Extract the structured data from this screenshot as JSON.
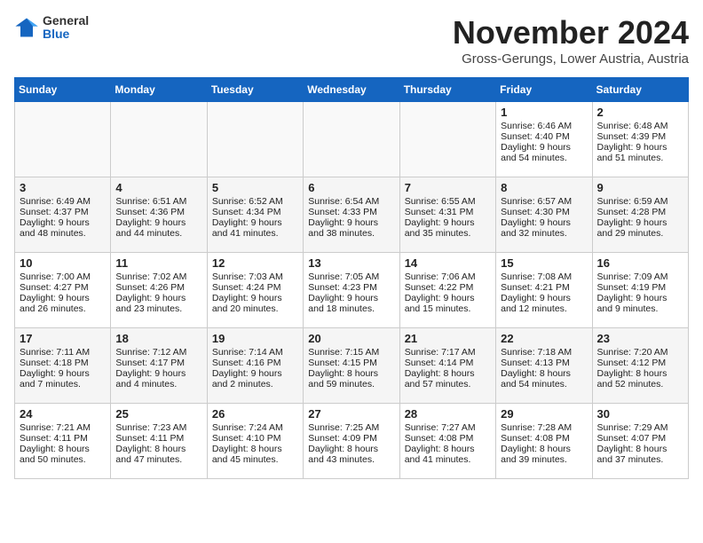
{
  "header": {
    "logo_general": "General",
    "logo_blue": "Blue",
    "month_title": "November 2024",
    "location": "Gross-Gerungs, Lower Austria, Austria"
  },
  "days_of_week": [
    "Sunday",
    "Monday",
    "Tuesday",
    "Wednesday",
    "Thursday",
    "Friday",
    "Saturday"
  ],
  "weeks": [
    {
      "days": [
        {
          "num": "",
          "content": ""
        },
        {
          "num": "",
          "content": ""
        },
        {
          "num": "",
          "content": ""
        },
        {
          "num": "",
          "content": ""
        },
        {
          "num": "",
          "content": ""
        },
        {
          "num": "1",
          "content": "Sunrise: 6:46 AM\nSunset: 4:40 PM\nDaylight: 9 hours and 54 minutes."
        },
        {
          "num": "2",
          "content": "Sunrise: 6:48 AM\nSunset: 4:39 PM\nDaylight: 9 hours and 51 minutes."
        }
      ]
    },
    {
      "days": [
        {
          "num": "3",
          "content": "Sunrise: 6:49 AM\nSunset: 4:37 PM\nDaylight: 9 hours and 48 minutes."
        },
        {
          "num": "4",
          "content": "Sunrise: 6:51 AM\nSunset: 4:36 PM\nDaylight: 9 hours and 44 minutes."
        },
        {
          "num": "5",
          "content": "Sunrise: 6:52 AM\nSunset: 4:34 PM\nDaylight: 9 hours and 41 minutes."
        },
        {
          "num": "6",
          "content": "Sunrise: 6:54 AM\nSunset: 4:33 PM\nDaylight: 9 hours and 38 minutes."
        },
        {
          "num": "7",
          "content": "Sunrise: 6:55 AM\nSunset: 4:31 PM\nDaylight: 9 hours and 35 minutes."
        },
        {
          "num": "8",
          "content": "Sunrise: 6:57 AM\nSunset: 4:30 PM\nDaylight: 9 hours and 32 minutes."
        },
        {
          "num": "9",
          "content": "Sunrise: 6:59 AM\nSunset: 4:28 PM\nDaylight: 9 hours and 29 minutes."
        }
      ]
    },
    {
      "days": [
        {
          "num": "10",
          "content": "Sunrise: 7:00 AM\nSunset: 4:27 PM\nDaylight: 9 hours and 26 minutes."
        },
        {
          "num": "11",
          "content": "Sunrise: 7:02 AM\nSunset: 4:26 PM\nDaylight: 9 hours and 23 minutes."
        },
        {
          "num": "12",
          "content": "Sunrise: 7:03 AM\nSunset: 4:24 PM\nDaylight: 9 hours and 20 minutes."
        },
        {
          "num": "13",
          "content": "Sunrise: 7:05 AM\nSunset: 4:23 PM\nDaylight: 9 hours and 18 minutes."
        },
        {
          "num": "14",
          "content": "Sunrise: 7:06 AM\nSunset: 4:22 PM\nDaylight: 9 hours and 15 minutes."
        },
        {
          "num": "15",
          "content": "Sunrise: 7:08 AM\nSunset: 4:21 PM\nDaylight: 9 hours and 12 minutes."
        },
        {
          "num": "16",
          "content": "Sunrise: 7:09 AM\nSunset: 4:19 PM\nDaylight: 9 hours and 9 minutes."
        }
      ]
    },
    {
      "days": [
        {
          "num": "17",
          "content": "Sunrise: 7:11 AM\nSunset: 4:18 PM\nDaylight: 9 hours and 7 minutes."
        },
        {
          "num": "18",
          "content": "Sunrise: 7:12 AM\nSunset: 4:17 PM\nDaylight: 9 hours and 4 minutes."
        },
        {
          "num": "19",
          "content": "Sunrise: 7:14 AM\nSunset: 4:16 PM\nDaylight: 9 hours and 2 minutes."
        },
        {
          "num": "20",
          "content": "Sunrise: 7:15 AM\nSunset: 4:15 PM\nDaylight: 8 hours and 59 minutes."
        },
        {
          "num": "21",
          "content": "Sunrise: 7:17 AM\nSunset: 4:14 PM\nDaylight: 8 hours and 57 minutes."
        },
        {
          "num": "22",
          "content": "Sunrise: 7:18 AM\nSunset: 4:13 PM\nDaylight: 8 hours and 54 minutes."
        },
        {
          "num": "23",
          "content": "Sunrise: 7:20 AM\nSunset: 4:12 PM\nDaylight: 8 hours and 52 minutes."
        }
      ]
    },
    {
      "days": [
        {
          "num": "24",
          "content": "Sunrise: 7:21 AM\nSunset: 4:11 PM\nDaylight: 8 hours and 50 minutes."
        },
        {
          "num": "25",
          "content": "Sunrise: 7:23 AM\nSunset: 4:11 PM\nDaylight: 8 hours and 47 minutes."
        },
        {
          "num": "26",
          "content": "Sunrise: 7:24 AM\nSunset: 4:10 PM\nDaylight: 8 hours and 45 minutes."
        },
        {
          "num": "27",
          "content": "Sunrise: 7:25 AM\nSunset: 4:09 PM\nDaylight: 8 hours and 43 minutes."
        },
        {
          "num": "28",
          "content": "Sunrise: 7:27 AM\nSunset: 4:08 PM\nDaylight: 8 hours and 41 minutes."
        },
        {
          "num": "29",
          "content": "Sunrise: 7:28 AM\nSunset: 4:08 PM\nDaylight: 8 hours and 39 minutes."
        },
        {
          "num": "30",
          "content": "Sunrise: 7:29 AM\nSunset: 4:07 PM\nDaylight: 8 hours and 37 minutes."
        }
      ]
    }
  ]
}
